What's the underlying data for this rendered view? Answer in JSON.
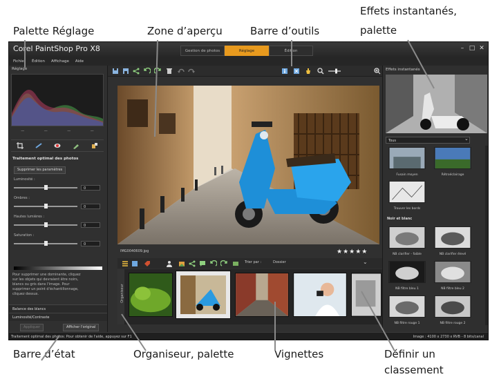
{
  "callouts": {
    "palette_reglage": "Palette Réglage",
    "zone_apercu": "Zone d’aperçu",
    "barre_outils": "Barre d’outils",
    "effets_1": "Effets instantanés,",
    "effets_2": "palette",
    "barre_etat": "Barre d’état",
    "organiseur": "Organiseur, palette",
    "vignettes": "Vignettes",
    "classement_1": "Définir un",
    "classement_2": "classement"
  },
  "app": {
    "title": "Corel PaintShop Pro X8",
    "workspace_tabs": [
      "Gestion de photos",
      "Réglage",
      "Édition"
    ],
    "active_tab": "Réglage",
    "window_controls": [
      "minimize-icon",
      "maximize-icon",
      "close-icon"
    ]
  },
  "menu": [
    "Fichier",
    "Édition",
    "Affichage",
    "Aide"
  ],
  "adjust": {
    "title": "Réglage",
    "histogram_labels": [
      "—",
      "—",
      "—",
      "—"
    ],
    "section": "Traitement optimal des photos",
    "suppress_button": "Supprimer les paramètres",
    "sliders": [
      {
        "label": "Luminosité :",
        "value": "0",
        "level": 0.48
      },
      {
        "label": "Ombres :",
        "value": "0",
        "level": 0.48
      },
      {
        "label": "Hautes lumières :",
        "value": "0",
        "level": 0.48
      },
      {
        "label": "Saturation :",
        "value": "0",
        "level": 0.48
      }
    ],
    "hint": "Pour supprimer une dominante, cliquez\nsur les objets qui devraient être noirs,\nblancs ou gris dans l'image. Pour\nsupprimer un point d'échantillonnage,\ncliquez dessus.",
    "collapsed": [
      "Balance des blancs",
      "Luminosité/Contraste"
    ],
    "apply_button": "Appliquer",
    "original_button": "Afficher l'original"
  },
  "center": {
    "toolbar_icons": [
      "save-icon",
      "save-as-icon",
      "share-icon",
      "rotate-left-icon",
      "rotate-right-icon",
      "delete-icon",
      "undo-icon",
      "redo-icon",
      "info-icon",
      "fit-icon",
      "pan-icon",
      "zoom-icon",
      "zoom-slider-icon",
      "zoom-in-icon"
    ],
    "photo_name": "IMG0040609.jpg",
    "stars": "★★★★★",
    "sort_label": "Trier par :",
    "sort_value": "Dossier",
    "organizer_label": "Organiseur"
  },
  "effects": {
    "title": "Effets instantanés",
    "category": "Tous",
    "tiles": [
      "Fusain moyen",
      "Rétroéclairage",
      "Trouver les bords"
    ],
    "group": "Noir et blanc",
    "bw_tiles": [
      "NB clarifier - faible",
      "NB clarifier élevé",
      "NB filtre bleu 1",
      "NB filtre bleu 2",
      "NB filtre rouge 1",
      "NB filtre rouge 2"
    ]
  },
  "status": {
    "left": "Traitement optimal des photos: Pour obtenir de l'aide, appuyez sur F1",
    "right": "Image : 4100 x 2730 x RVB - 8 bits/canal"
  }
}
